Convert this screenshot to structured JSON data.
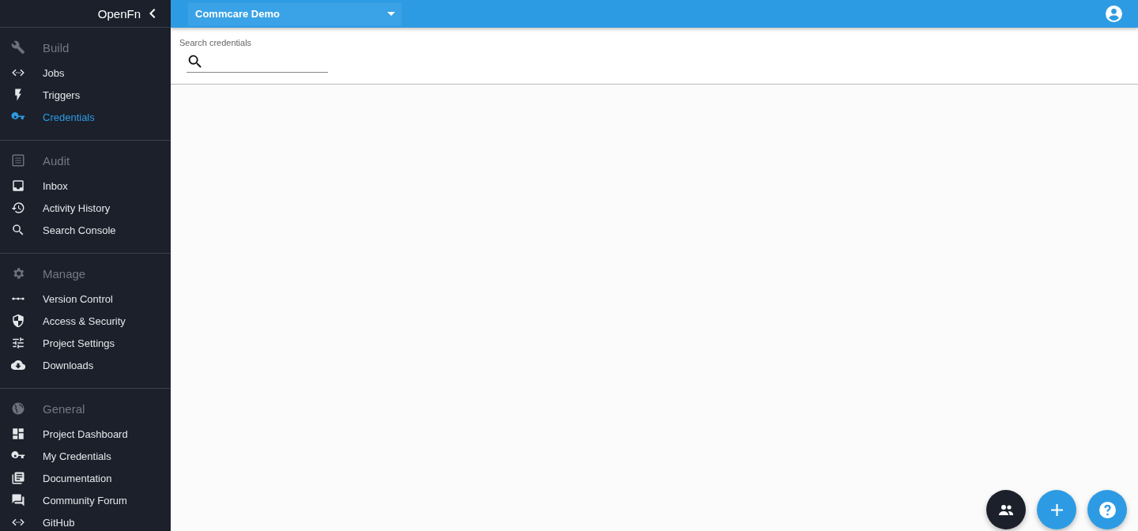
{
  "app": {
    "title": "OpenFn"
  },
  "project_selector": {
    "value": "Commcare Demo"
  },
  "search": {
    "label": "Search credentials"
  },
  "nav_groups": [
    {
      "title": "Build",
      "items": [
        {
          "label": "Jobs",
          "selected": false
        },
        {
          "label": "Triggers",
          "selected": false
        },
        {
          "label": "Credentials",
          "selected": true
        }
      ]
    },
    {
      "title": "Audit",
      "items": [
        {
          "label": "Inbox",
          "selected": false
        },
        {
          "label": "Activity History",
          "selected": false
        },
        {
          "label": "Search Console",
          "selected": false
        }
      ]
    },
    {
      "title": "Manage",
      "items": [
        {
          "label": "Version Control",
          "selected": false
        },
        {
          "label": "Access & Security",
          "selected": false
        },
        {
          "label": "Project Settings",
          "selected": false
        },
        {
          "label": "Downloads",
          "selected": false
        }
      ]
    },
    {
      "title": "General",
      "items": [
        {
          "label": "Project Dashboard",
          "selected": false
        },
        {
          "label": "My Credentials",
          "selected": false
        },
        {
          "label": "Documentation",
          "selected": false
        },
        {
          "label": "Community Forum",
          "selected": false
        },
        {
          "label": "GitHub",
          "selected": false
        }
      ]
    }
  ]
}
